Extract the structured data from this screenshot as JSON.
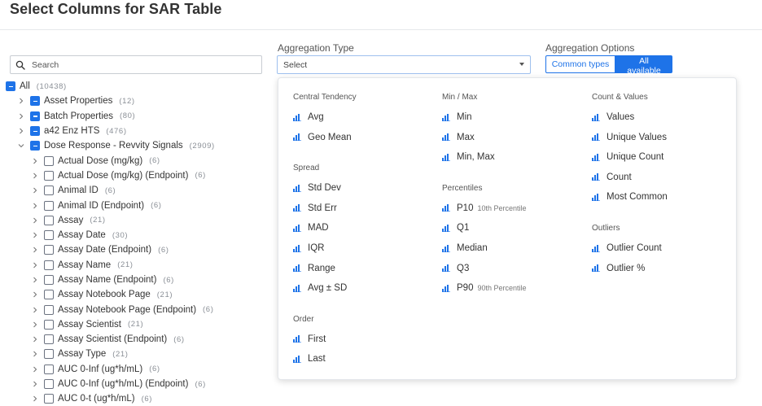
{
  "page": {
    "title": "Select Columns for SAR Table"
  },
  "search": {
    "placeholder": "Search"
  },
  "tree": [
    {
      "label": "All",
      "count": "(10438)",
      "level": 0,
      "state": "indeterminate",
      "chevron": "none"
    },
    {
      "label": "Asset Properties",
      "count": "(12)",
      "level": 1,
      "state": "indeterminate",
      "chevron": "right"
    },
    {
      "label": "Batch Properties",
      "count": "(80)",
      "level": 1,
      "state": "indeterminate",
      "chevron": "right"
    },
    {
      "label": "a42 Enz HTS",
      "count": "(476)",
      "level": 1,
      "state": "indeterminate",
      "chevron": "right"
    },
    {
      "label": "Dose Response - Revvity Signals",
      "count": "(2909)",
      "level": 1,
      "state": "indeterminate",
      "chevron": "down"
    },
    {
      "label": "Actual Dose (mg/kg)",
      "count": "(6)",
      "level": 2,
      "state": "unchecked",
      "chevron": "right"
    },
    {
      "label": "Actual Dose (mg/kg) (Endpoint)",
      "count": "(6)",
      "level": 2,
      "state": "unchecked",
      "chevron": "right"
    },
    {
      "label": "Animal ID",
      "count": "(6)",
      "level": 2,
      "state": "unchecked",
      "chevron": "right"
    },
    {
      "label": "Animal ID (Endpoint)",
      "count": "(6)",
      "level": 2,
      "state": "unchecked",
      "chevron": "right"
    },
    {
      "label": "Assay",
      "count": "(21)",
      "level": 2,
      "state": "unchecked",
      "chevron": "right"
    },
    {
      "label": "Assay Date",
      "count": "(30)",
      "level": 2,
      "state": "unchecked",
      "chevron": "right"
    },
    {
      "label": "Assay Date (Endpoint)",
      "count": "(6)",
      "level": 2,
      "state": "unchecked",
      "chevron": "right"
    },
    {
      "label": "Assay Name",
      "count": "(21)",
      "level": 2,
      "state": "unchecked",
      "chevron": "right"
    },
    {
      "label": "Assay Name (Endpoint)",
      "count": "(6)",
      "level": 2,
      "state": "unchecked",
      "chevron": "right"
    },
    {
      "label": "Assay Notebook Page",
      "count": "(21)",
      "level": 2,
      "state": "unchecked",
      "chevron": "right"
    },
    {
      "label": "Assay Notebook Page (Endpoint)",
      "count": "(6)",
      "level": 2,
      "state": "unchecked",
      "chevron": "right"
    },
    {
      "label": "Assay Scientist",
      "count": "(21)",
      "level": 2,
      "state": "unchecked",
      "chevron": "right"
    },
    {
      "label": "Assay Scientist (Endpoint)",
      "count": "(6)",
      "level": 2,
      "state": "unchecked",
      "chevron": "right"
    },
    {
      "label": "Assay Type",
      "count": "(21)",
      "level": 2,
      "state": "unchecked",
      "chevron": "right"
    },
    {
      "label": "AUC 0-Inf (ug*h/mL)",
      "count": "(6)",
      "level": 2,
      "state": "unchecked",
      "chevron": "right"
    },
    {
      "label": "AUC 0-Inf (ug*h/mL) (Endpoint)",
      "count": "(6)",
      "level": 2,
      "state": "unchecked",
      "chevron": "right"
    },
    {
      "label": "AUC 0-t (ug*h/mL)",
      "count": "(6)",
      "level": 2,
      "state": "unchecked",
      "chevron": "right"
    }
  ],
  "aggregation_type": {
    "label": "Aggregation Type",
    "selected": "Select"
  },
  "aggregation_options": {
    "label": "Aggregation Options",
    "common": "Common types",
    "all": "All available",
    "active": "all"
  },
  "dropdown": {
    "columns": [
      {
        "sections": [
          {
            "title": "Central Tendency",
            "options": [
              {
                "label": "Avg"
              },
              {
                "label": "Geo Mean"
              }
            ]
          },
          {
            "title": "Spread",
            "options": [
              {
                "label": "Std Dev"
              },
              {
                "label": "Std Err"
              },
              {
                "label": "MAD"
              },
              {
                "label": "IQR"
              },
              {
                "label": "Range"
              },
              {
                "label": "Avg ± SD"
              }
            ]
          },
          {
            "title": "Order",
            "options": [
              {
                "label": "First"
              },
              {
                "label": "Last"
              }
            ]
          }
        ]
      },
      {
        "sections": [
          {
            "title": "Min / Max",
            "options": [
              {
                "label": "Min"
              },
              {
                "label": "Max"
              },
              {
                "label": "Min, Max"
              }
            ]
          },
          {
            "title": "Percentiles",
            "options": [
              {
                "label": "P10",
                "sub": "10th Percentile"
              },
              {
                "label": "Q1"
              },
              {
                "label": "Median"
              },
              {
                "label": "Q3"
              },
              {
                "label": "P90",
                "sub": "90th Percentile"
              }
            ]
          }
        ]
      },
      {
        "sections": [
          {
            "title": "Count & Values",
            "options": [
              {
                "label": "Values"
              },
              {
                "label": "Unique Values"
              },
              {
                "label": "Unique Count"
              },
              {
                "label": "Count"
              },
              {
                "label": "Most Common"
              }
            ]
          },
          {
            "title": "Outliers",
            "options": [
              {
                "label": "Outlier Count"
              },
              {
                "label": "Outlier %"
              }
            ]
          }
        ]
      }
    ]
  },
  "colors": {
    "accent": "#1e73e8",
    "text": "#333333",
    "muted": "#8a8f96",
    "icon": "#1e73e8"
  },
  "icons": {
    "search": "magnifier-icon",
    "option": "bar-chart-icon",
    "chevron": "chevron-icon"
  }
}
